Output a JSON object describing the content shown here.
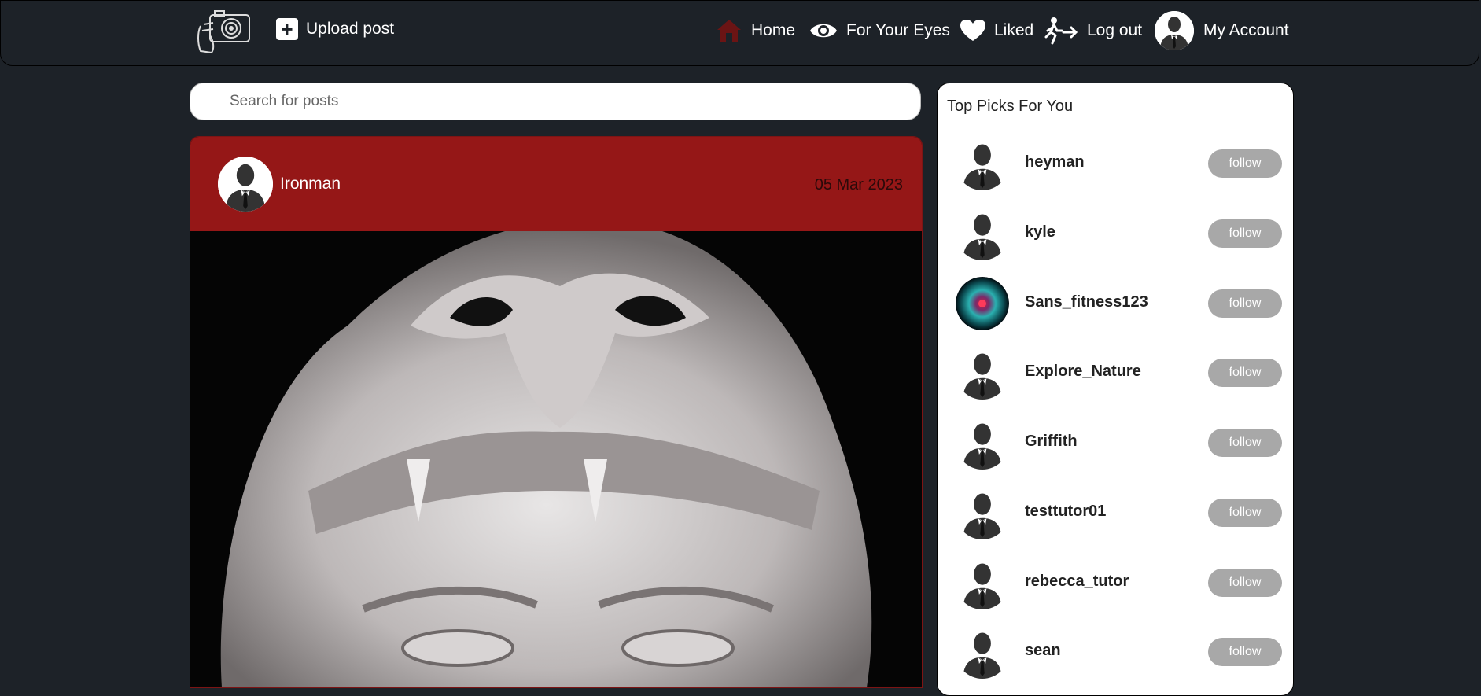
{
  "nav": {
    "upload_label": "Upload post",
    "home_label": "Home",
    "eyes_label": "For Your Eyes",
    "liked_label": "Liked",
    "logout_label": "Log out",
    "account_label": "My Account"
  },
  "search": {
    "placeholder": "Search for posts"
  },
  "post": {
    "user": "Ironman",
    "date": "05 Mar 2023"
  },
  "picks": {
    "title": "Top Picks For You",
    "follow_label": "follow",
    "users": [
      {
        "name": "heyman",
        "avatar": "silhouette"
      },
      {
        "name": "kyle",
        "avatar": "silhouette"
      },
      {
        "name": "Sans_fitness123",
        "avatar": "nebula"
      },
      {
        "name": "Explore_Nature",
        "avatar": "silhouette"
      },
      {
        "name": "Griffith",
        "avatar": "silhouette"
      },
      {
        "name": "testtutor01",
        "avatar": "silhouette"
      },
      {
        "name": "rebecca_tutor",
        "avatar": "silhouette"
      },
      {
        "name": "sean",
        "avatar": "silhouette"
      }
    ]
  },
  "colors": {
    "bg": "#1d2228",
    "post_header": "#951717",
    "follow_bg": "#a8a8a8",
    "home_icon": "#6b1414"
  }
}
